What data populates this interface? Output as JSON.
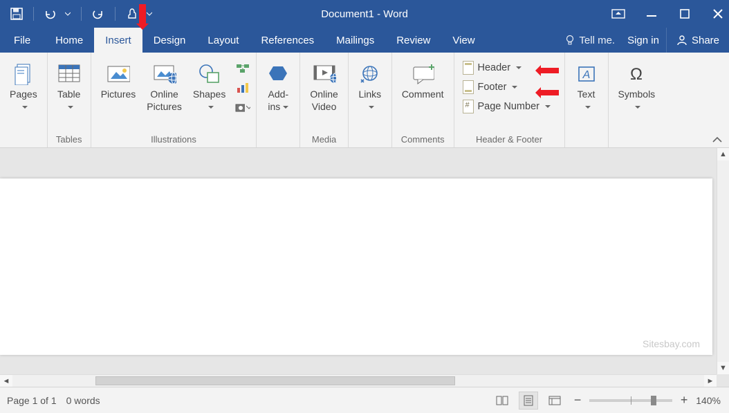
{
  "title": "Document1 - Word",
  "tabs": {
    "file": "File",
    "home": "Home",
    "insert": "Insert",
    "design": "Design",
    "layout": "Layout",
    "references": "References",
    "mailings": "Mailings",
    "review": "Review",
    "view": "View",
    "tellme": "Tell me.",
    "signin": "Sign in",
    "share": "Share"
  },
  "groups": {
    "pages": {
      "pages": "Pages"
    },
    "tables": {
      "table": "Table",
      "label": "Tables"
    },
    "illustrations": {
      "pictures": "Pictures",
      "online_pictures": "Online\nPictures",
      "shapes": "Shapes",
      "label": "Illustrations"
    },
    "addins": {
      "addins": "Add-\nins",
      "label": ""
    },
    "media": {
      "online_video": "Online\nVideo",
      "label": "Media"
    },
    "links": {
      "links": "Links"
    },
    "comments": {
      "comment": "Comment",
      "label": "Comments"
    },
    "header_footer": {
      "header": "Header",
      "footer": "Footer",
      "page_number": "Page Number",
      "label": "Header & Footer"
    },
    "text": {
      "text": "Text"
    },
    "symbols": {
      "symbols": "Symbols"
    }
  },
  "status": {
    "page": "Page 1 of 1",
    "words": "0 words",
    "zoom": "140%"
  },
  "watermark": "Sitesbay.com"
}
